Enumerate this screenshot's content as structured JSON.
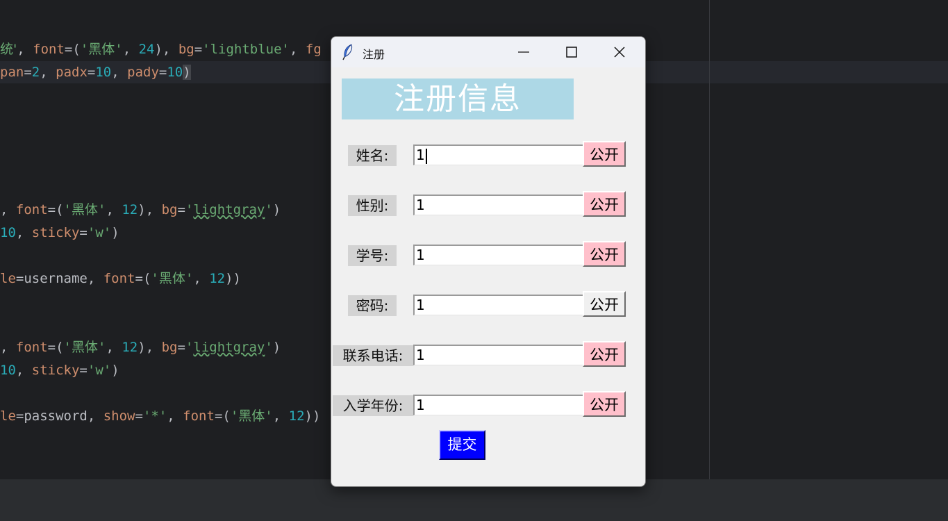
{
  "editor": {
    "lines": [
      {
        "parts": [
          {
            "t": "统'",
            "c": "st cn"
          },
          {
            "t": ", ",
            "c": ""
          },
          {
            "t": "font",
            "c": "par"
          },
          {
            "t": "=(",
            "c": ""
          },
          {
            "t": "'",
            "c": "st"
          },
          {
            "t": "黑体",
            "c": "st cn"
          },
          {
            "t": "'",
            "c": "st"
          },
          {
            "t": ", ",
            "c": ""
          },
          {
            "t": "24",
            "c": "nm"
          },
          {
            "t": "), ",
            "c": ""
          },
          {
            "t": "bg",
            "c": "par"
          },
          {
            "t": "=",
            "c": ""
          },
          {
            "t": "'lightblue'",
            "c": "st"
          },
          {
            "t": ", ",
            "c": ""
          },
          {
            "t": "fg",
            "c": "par"
          }
        ]
      },
      {
        "parts": [
          {
            "t": "pan",
            "c": "par"
          },
          {
            "t": "=",
            "c": ""
          },
          {
            "t": "2",
            "c": "nm"
          },
          {
            "t": ", ",
            "c": ""
          },
          {
            "t": "padx",
            "c": "par"
          },
          {
            "t": "=",
            "c": ""
          },
          {
            "t": "10",
            "c": "nm"
          },
          {
            "t": ", ",
            "c": ""
          },
          {
            "t": "pady",
            "c": "par"
          },
          {
            "t": "=",
            "c": ""
          },
          {
            "t": "10",
            "c": "nm"
          },
          {
            "t": ")",
            "c": "brace-hl"
          }
        ]
      },
      {
        "parts": [
          {
            "t": ", ",
            "c": ""
          },
          {
            "t": "font",
            "c": "par"
          },
          {
            "t": "=(",
            "c": ""
          },
          {
            "t": "'",
            "c": "st"
          },
          {
            "t": "黑体",
            "c": "st cn"
          },
          {
            "t": "'",
            "c": "st"
          },
          {
            "t": ", ",
            "c": ""
          },
          {
            "t": "12",
            "c": "nm"
          },
          {
            "t": "), ",
            "c": ""
          },
          {
            "t": "bg",
            "c": "par"
          },
          {
            "t": "=",
            "c": ""
          },
          {
            "t": "'",
            "c": "st"
          },
          {
            "t": "lightgray",
            "c": "st sq"
          },
          {
            "t": "'",
            "c": "st"
          },
          {
            "t": ")",
            "c": ""
          }
        ]
      },
      {
        "parts": [
          {
            "t": "10",
            "c": "nm"
          },
          {
            "t": ", ",
            "c": ""
          },
          {
            "t": "sticky",
            "c": "par"
          },
          {
            "t": "=",
            "c": ""
          },
          {
            "t": "'w'",
            "c": "st"
          },
          {
            "t": ")",
            "c": ""
          }
        ]
      },
      {
        "parts": [
          {
            "t": "le",
            "c": "par"
          },
          {
            "t": "=username, ",
            "c": ""
          },
          {
            "t": "font",
            "c": "par"
          },
          {
            "t": "=(",
            "c": ""
          },
          {
            "t": "'",
            "c": "st"
          },
          {
            "t": "黑体",
            "c": "st cn"
          },
          {
            "t": "'",
            "c": "st"
          },
          {
            "t": ", ",
            "c": ""
          },
          {
            "t": "12",
            "c": "nm"
          },
          {
            "t": "))",
            "c": ""
          }
        ]
      },
      {
        "parts": [
          {
            "t": ", ",
            "c": ""
          },
          {
            "t": "font",
            "c": "par"
          },
          {
            "t": "=(",
            "c": ""
          },
          {
            "t": "'",
            "c": "st"
          },
          {
            "t": "黑体",
            "c": "st cn"
          },
          {
            "t": "'",
            "c": "st"
          },
          {
            "t": ", ",
            "c": ""
          },
          {
            "t": "12",
            "c": "nm"
          },
          {
            "t": "), ",
            "c": ""
          },
          {
            "t": "bg",
            "c": "par"
          },
          {
            "t": "=",
            "c": ""
          },
          {
            "t": "'",
            "c": "st"
          },
          {
            "t": "lightgray",
            "c": "st sq"
          },
          {
            "t": "'",
            "c": "st"
          },
          {
            "t": ")",
            "c": ""
          }
        ]
      },
      {
        "parts": [
          {
            "t": "10",
            "c": "nm"
          },
          {
            "t": ", ",
            "c": ""
          },
          {
            "t": "sticky",
            "c": "par"
          },
          {
            "t": "=",
            "c": ""
          },
          {
            "t": "'w'",
            "c": "st"
          },
          {
            "t": ")",
            "c": ""
          }
        ]
      },
      {
        "parts": [
          {
            "t": "le",
            "c": "par"
          },
          {
            "t": "=password, ",
            "c": ""
          },
          {
            "t": "show",
            "c": "par"
          },
          {
            "t": "=",
            "c": ""
          },
          {
            "t": "'*'",
            "c": "st"
          },
          {
            "t": ", ",
            "c": ""
          },
          {
            "t": "font",
            "c": "par"
          },
          {
            "t": "=(",
            "c": ""
          },
          {
            "t": "'",
            "c": "st"
          },
          {
            "t": "黑体",
            "c": "st cn"
          },
          {
            "t": "'",
            "c": "st"
          },
          {
            "t": ", ",
            "c": ""
          },
          {
            "t": "12",
            "c": "nm"
          },
          {
            "t": "))",
            "c": ""
          }
        ]
      }
    ]
  },
  "window": {
    "title": "注册",
    "banner": "注册信息",
    "fields": [
      {
        "label": "姓名:",
        "value": "1",
        "button": "公开",
        "public": true
      },
      {
        "label": "性别:",
        "value": "1",
        "button": "公开",
        "public": true
      },
      {
        "label": "学号:",
        "value": "1",
        "button": "公开",
        "public": true
      },
      {
        "label": "密码:",
        "value": "1",
        "button": "公开",
        "public": false
      },
      {
        "label": "联系电话:",
        "value": "1",
        "button": "公开",
        "public": true
      },
      {
        "label": "入学年份:",
        "value": "1",
        "button": "公开",
        "public": true
      }
    ],
    "submit_label": "提交"
  },
  "colors": {
    "banner_bg": "#add8e6",
    "label_bg": "#d3d3d3",
    "public_button_bg": "#ffc0cb",
    "submit_bg": "#0000ff"
  }
}
